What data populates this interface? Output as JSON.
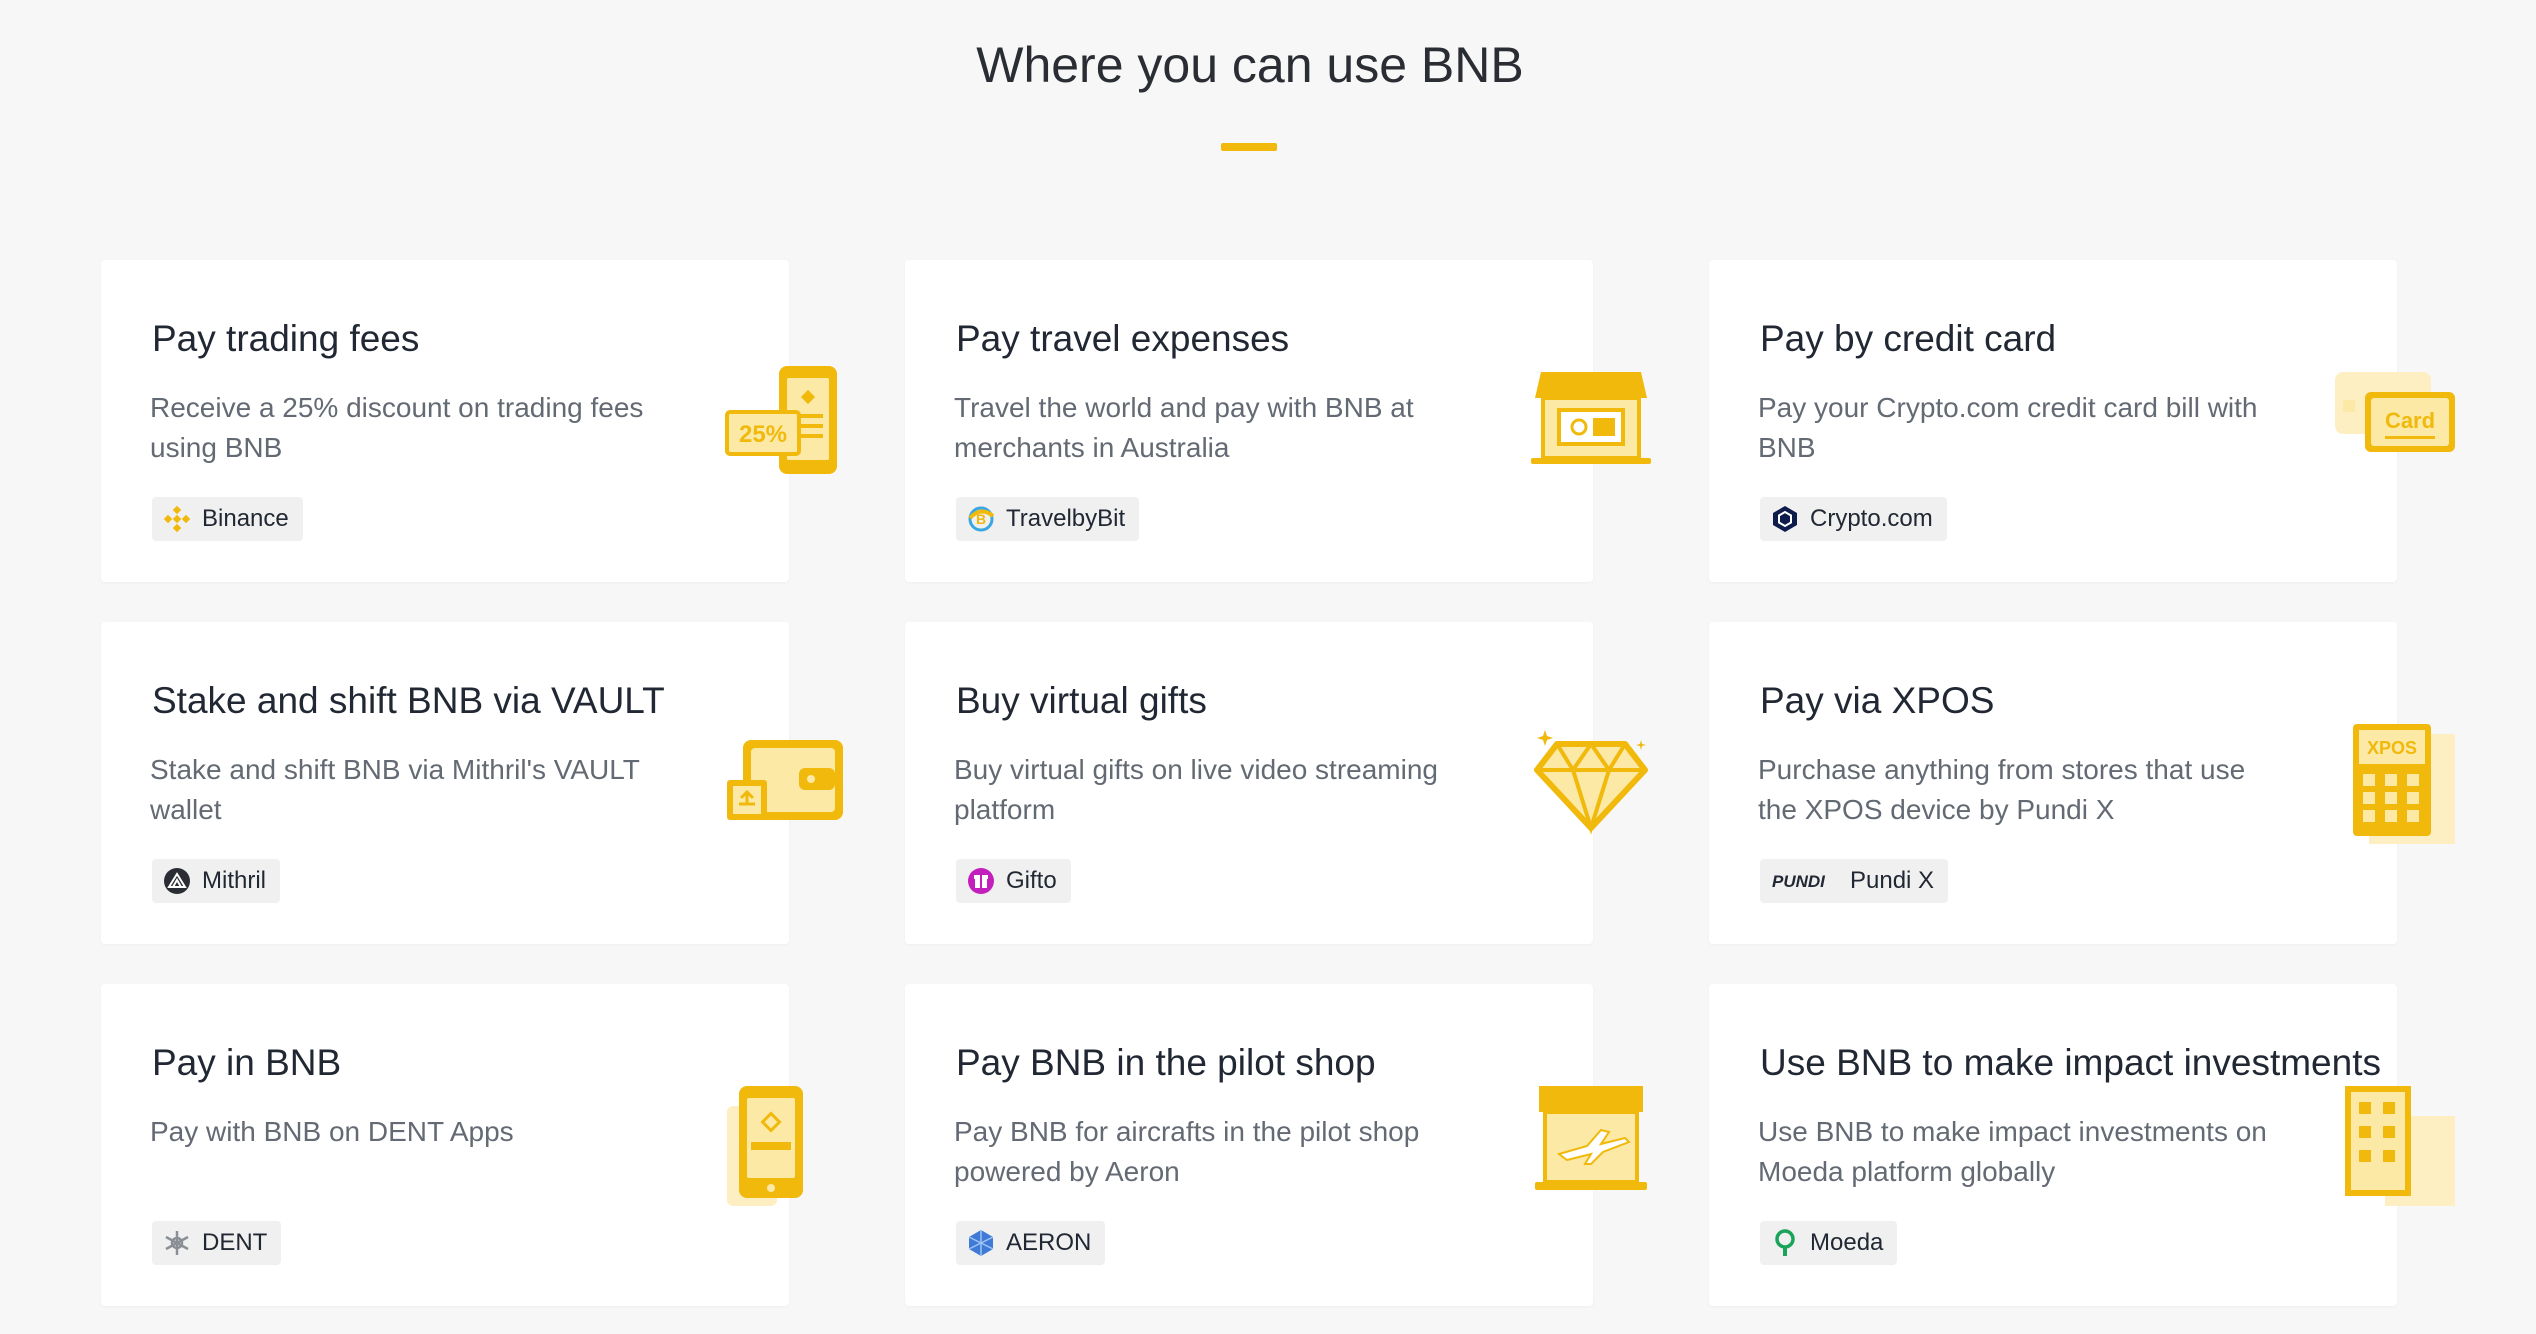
{
  "page": {
    "title": "Where you can use BNB"
  },
  "accent_color": "#f0b90b",
  "cards": [
    {
      "title": "Pay trading fees",
      "description": "Receive a 25% discount on trading fees using BNB",
      "partner": "Binance",
      "partner_icon": "binance-logo-icon",
      "illustration": "phone-discount-icon",
      "illustration_text": "25%"
    },
    {
      "title": "Pay travel expenses",
      "description": "Travel the world and pay with BNB at merchants in Australia",
      "partner": "TravelbyBit",
      "partner_icon": "travelbybit-logo-icon",
      "illustration": "storefront-icon"
    },
    {
      "title": "Pay by credit card",
      "description": "Pay your Crypto.com credit card bill with BNB",
      "partner": "Crypto.com",
      "partner_icon": "crypto-com-logo-icon",
      "illustration": "credit-card-icon",
      "illustration_text": "Card"
    },
    {
      "title": "Stake and shift BNB via VAULT",
      "description": "Stake and shift BNB via Mithril's VAULT wallet",
      "partner": "Mithril",
      "partner_icon": "mithril-logo-icon",
      "illustration": "wallet-icon"
    },
    {
      "title": "Buy virtual gifts",
      "description": "Buy virtual gifts on live video streaming platform",
      "partner": "Gifto",
      "partner_icon": "gifto-logo-icon",
      "illustration": "diamond-icon"
    },
    {
      "title": "Pay via XPOS",
      "description": "Purchase anything from stores that use the XPOS device by Pundi X",
      "partner": "Pundi X",
      "partner_icon": "pundi-x-logo-icon",
      "partner_logo_text": "PUNDI",
      "illustration": "xpos-device-icon",
      "illustration_text": "XPOS"
    },
    {
      "title": "Pay in BNB",
      "description": "Pay with BNB on DENT Apps",
      "partner": "DENT",
      "partner_icon": "dent-logo-icon",
      "illustration": "mobile-phone-icon"
    },
    {
      "title": "Pay BNB in the pilot shop",
      "description": "Pay BNB for aircrafts in the pilot shop powered by Aeron",
      "partner": "AERON",
      "partner_icon": "aeron-logo-icon",
      "illustration": "airplane-shop-icon"
    },
    {
      "title": "Use BNB to make impact investments",
      "description": "Use BNB to make impact investments on Moeda platform globally",
      "partner": "Moeda",
      "partner_icon": "moeda-logo-icon",
      "illustration": "building-icon"
    }
  ]
}
